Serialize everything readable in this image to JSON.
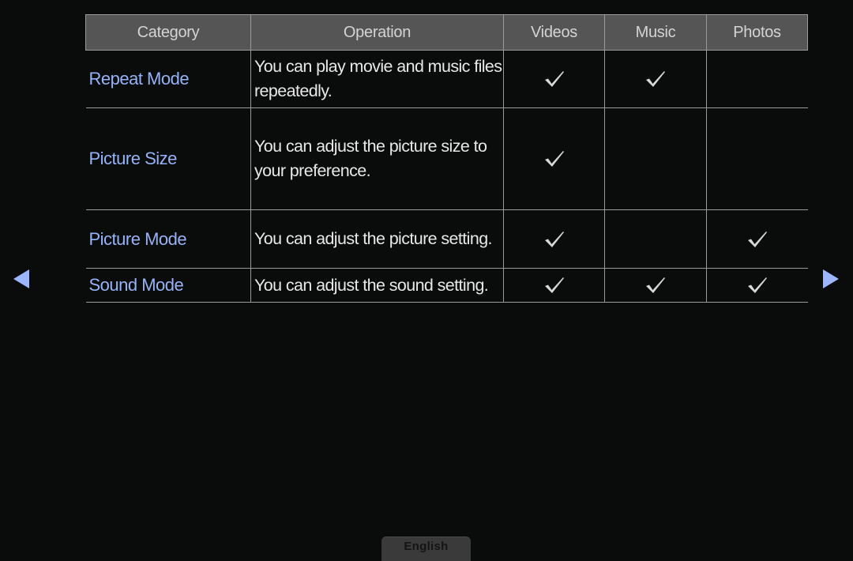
{
  "table": {
    "headers": [
      "Category",
      "Operation",
      "Videos",
      "Music",
      "Photos"
    ],
    "rows": [
      {
        "category": "Repeat Mode",
        "operation": "You can play movie and music files repeatedly.",
        "videos": true,
        "music": true,
        "photos": false
      },
      {
        "category": "Picture Size",
        "operation": "You can adjust the picture size to your preference.",
        "videos": true,
        "music": false,
        "photos": false
      },
      {
        "category": "Picture Mode",
        "operation": "You can adjust the picture setting.",
        "videos": true,
        "music": false,
        "photos": true
      },
      {
        "category": "Sound Mode",
        "operation": "You can adjust the sound setting.",
        "videos": true,
        "music": true,
        "photos": true
      }
    ]
  },
  "navigation": {
    "prev_icon": "triangle-left",
    "next_icon": "triangle-right",
    "accent_color": "#9cb6ff"
  },
  "footer": {
    "language_label": "English"
  },
  "colors": {
    "category_text": "#95b3f7",
    "header_bg": "#555555",
    "background": "#0a0b0b"
  }
}
